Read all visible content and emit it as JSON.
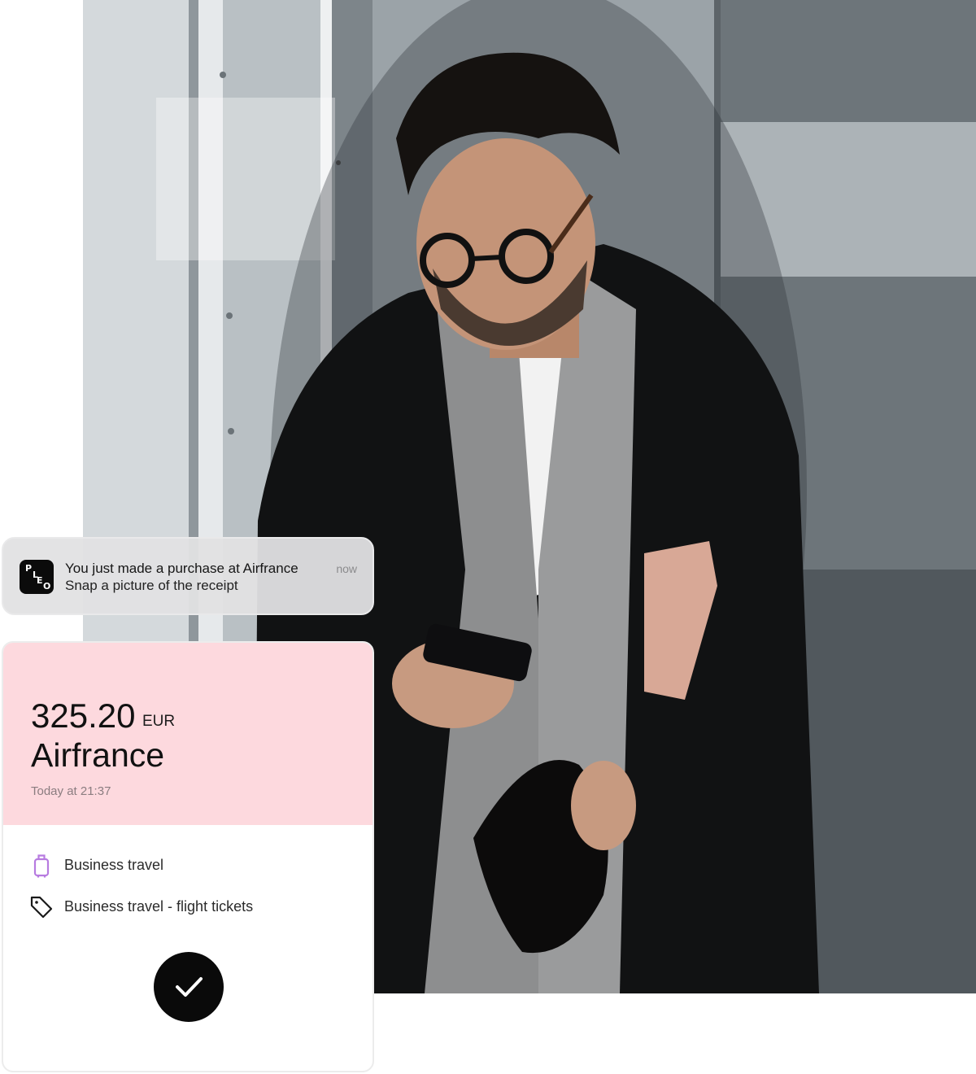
{
  "notification": {
    "app_icon": "pleo-logo-icon",
    "logo_letters": [
      "P",
      "L",
      "E",
      "O"
    ],
    "title": "You just made a purchase at Airfrance",
    "subtitle": "Snap a picture of the receipt",
    "time": "now"
  },
  "expense": {
    "amount": "325.20",
    "currency": "EUR",
    "merchant": "Airfrance",
    "date": "Today at 21:37",
    "accent_color": "#fdd9de",
    "category": {
      "icon": "suitcase-icon",
      "icon_color": "#b77be0",
      "label": "Business travel"
    },
    "tag": {
      "icon": "tag-icon",
      "label": "Business travel - flight tickets"
    },
    "confirm": {
      "icon": "checkmark-icon"
    }
  },
  "photo": {
    "subject": "man-in-elevator-with-phone-photo"
  }
}
